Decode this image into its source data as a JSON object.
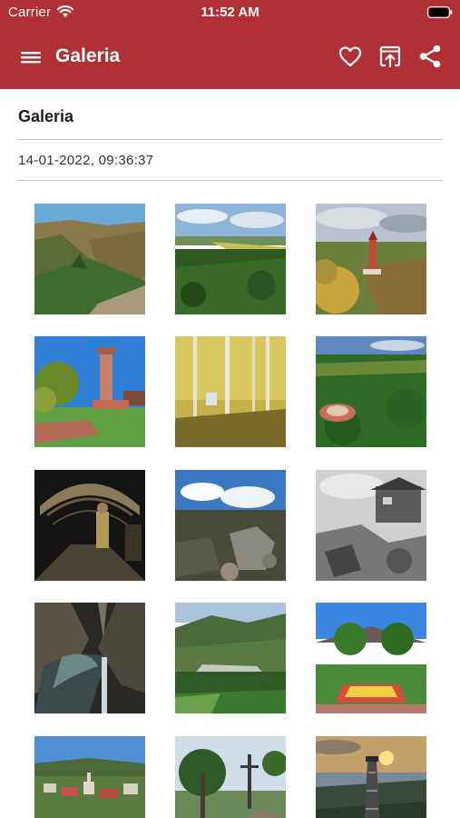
{
  "status_bar": {
    "carrier": "Carrier",
    "time": "11:52 AM"
  },
  "app_bar": {
    "title": "Galeria",
    "menu_icon": "hamburger-menu-icon",
    "actions": [
      "heart-icon",
      "open-external-icon",
      "share-icon"
    ]
  },
  "gallery": {
    "title": "Galeria",
    "date": "14-01-2022, 09:36:37",
    "photo_count": 15
  },
  "colors": {
    "accent": "#b03035",
    "background": "#ffffff",
    "divider": "#c9c9c9"
  }
}
